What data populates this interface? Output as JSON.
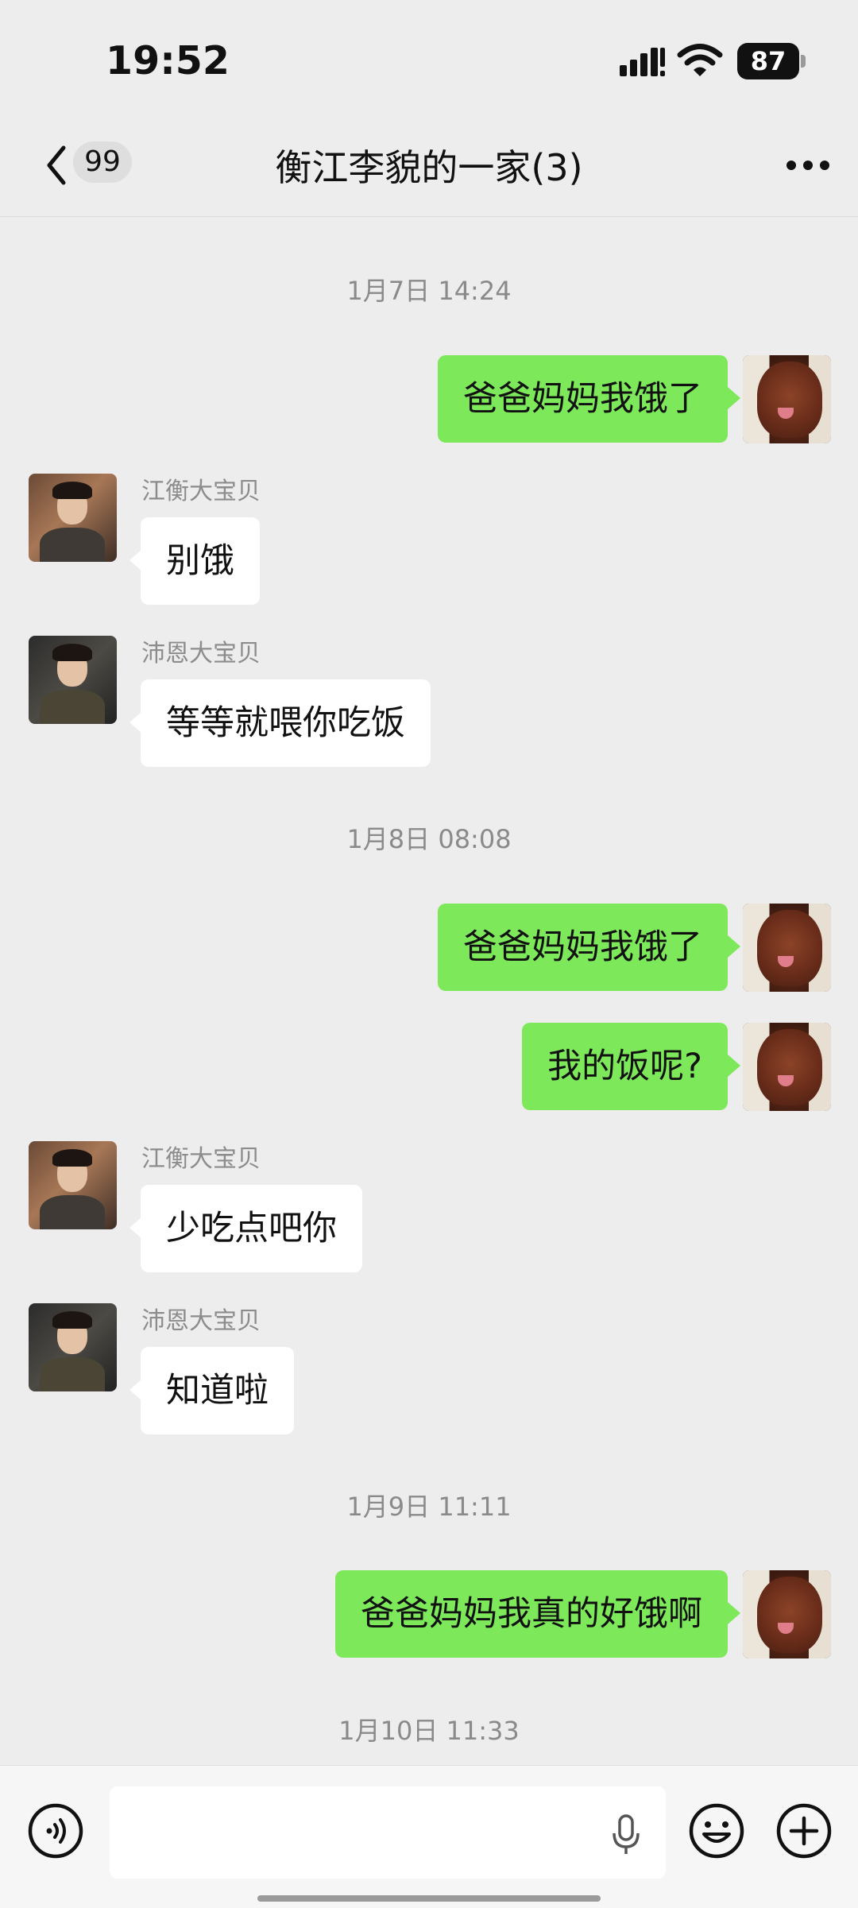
{
  "status_bar": {
    "time": "19:52",
    "battery": "87"
  },
  "nav": {
    "unread_count": "99",
    "title": "衡江李貌的一家(3)"
  },
  "chat": {
    "ts1": "1月7日 14:24",
    "m1": "爸爸妈妈我饿了",
    "m2_sender": "江衡大宝贝",
    "m2": "别饿",
    "m3_sender": "沛恩大宝贝",
    "m3": "等等就喂你吃饭",
    "ts2": "1月8日 08:08",
    "m4": "爸爸妈妈我饿了",
    "m5": "我的饭呢?",
    "m6_sender": "江衡大宝贝",
    "m6": "少吃点吧你",
    "m7_sender": "沛恩大宝贝",
    "m7": "知道啦",
    "ts3": "1月9日 11:11",
    "m8": "爸爸妈妈我真的好饿啊",
    "ts4": "1月10日 11:33"
  },
  "input": {
    "value": "",
    "placeholder": ""
  },
  "colors": {
    "outgoing_bubble": "#7ce85a",
    "incoming_bubble": "#ffffff",
    "background": "#ededed"
  },
  "icons": [
    "back-icon",
    "more-icon",
    "voice-icon",
    "mic-icon",
    "emoji-icon",
    "plus-icon",
    "signal-icon",
    "wifi-icon",
    "battery-icon"
  ]
}
